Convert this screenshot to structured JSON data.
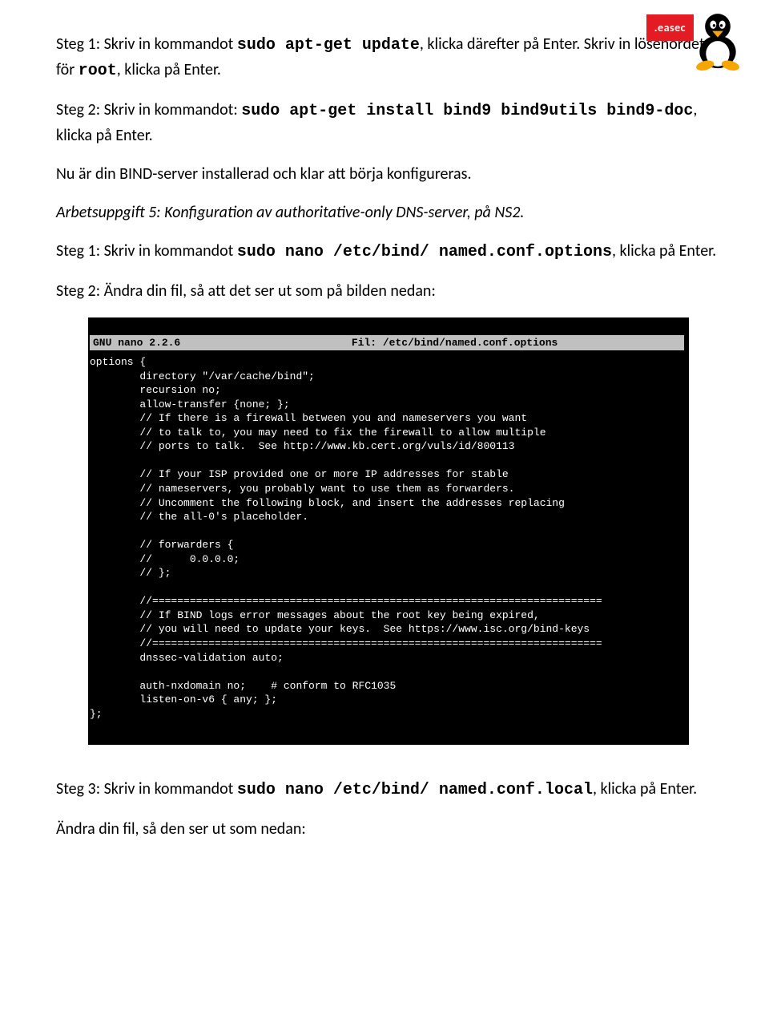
{
  "logo": {
    "brand": ".easec"
  },
  "para1": {
    "pre": "Steg 1: Skriv in kommandot ",
    "cmd": "sudo apt-get update",
    "mid": ", klicka därefter på Enter. Skriv in lösenordet för ",
    "cmd2": "root",
    "post": ", klicka på Enter."
  },
  "para2": {
    "pre": "Steg 2: Skriv in kommandot: ",
    "cmd": "sudo apt-get install bind9 bind9utils bind9-doc",
    "post": ", klicka på Enter."
  },
  "para3": "Nu är din BIND-server installerad och klar att börja konfigureras.",
  "para4": "Arbetsuppgift 5: Konfiguration av authoritative-only DNS-server, på NS2.",
  "para5": {
    "pre": "Steg 1: Skriv in kommandot ",
    "cmd": "sudo nano /etc/bind/ named.conf.options",
    "post": ", klicka på Enter."
  },
  "para6": "Steg 2: Ändra din fil, så att det ser ut som på bilden nedan:",
  "terminal": {
    "app": "GNU nano 2.2.6",
    "file": "Fil: /etc/bind/named.conf.options",
    "body": "options {\n        directory \"/var/cache/bind\";\n        recursion no;\n        allow-transfer {none; };\n        // If there is a firewall between you and nameservers you want\n        // to talk to, you may need to fix the firewall to allow multiple\n        // ports to talk.  See http://www.kb.cert.org/vuls/id/800113\n\n        // If your ISP provided one or more IP addresses for stable\n        // nameservers, you probably want to use them as forwarders.\n        // Uncomment the following block, and insert the addresses replacing\n        // the all-0's placeholder.\n\n        // forwarders {\n        //      0.0.0.0;\n        // };\n\n        //========================================================================\n        // If BIND logs error messages about the root key being expired,\n        // you will need to update your keys.  See https://www.isc.org/bind-keys\n        //========================================================================\n        dnssec-validation auto;\n\n        auth-nxdomain no;    # conform to RFC1035\n        listen-on-v6 { any; };\n};"
  },
  "para7": {
    "pre": "Steg 3: Skriv in kommandot ",
    "cmd": "sudo nano /etc/bind/ named.conf.local",
    "post": ", klicka på Enter."
  },
  "para8": "Ändra din fil, så den ser ut som nedan:"
}
